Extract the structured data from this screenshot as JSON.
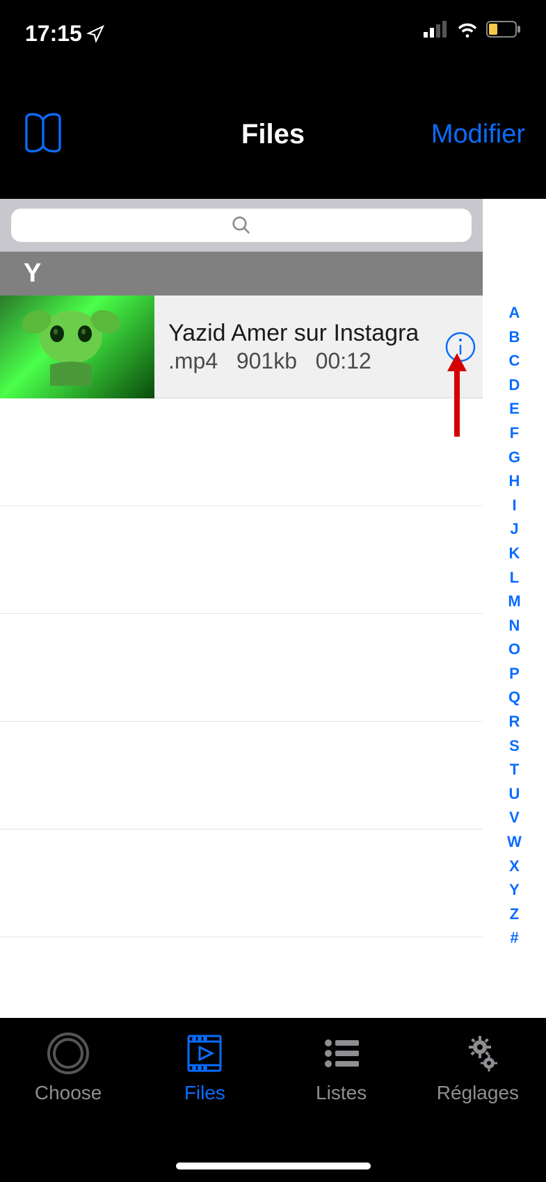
{
  "statusBar": {
    "time": "17:15"
  },
  "navBar": {
    "title": "Files",
    "rightAction": "Modifier"
  },
  "sectionHeader": "Y",
  "file": {
    "title": "Yazid Amer sur Instagra",
    "ext": ".mp4",
    "size": "901kb",
    "duration": "00:12"
  },
  "alphaIndex": [
    "A",
    "B",
    "C",
    "D",
    "E",
    "F",
    "G",
    "H",
    "I",
    "J",
    "K",
    "L",
    "M",
    "N",
    "O",
    "P",
    "Q",
    "R",
    "S",
    "T",
    "U",
    "V",
    "W",
    "X",
    "Y",
    "Z",
    "#"
  ],
  "tabs": {
    "choose": "Choose",
    "files": "Files",
    "listes": "Listes",
    "reglages": "Réglages"
  }
}
